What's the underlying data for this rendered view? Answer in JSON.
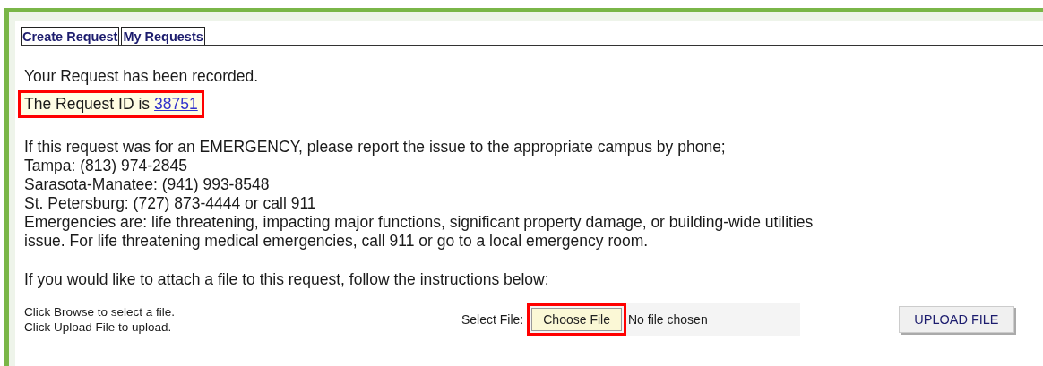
{
  "tabs": [
    {
      "label": "Create Request"
    },
    {
      "label": "My Requests"
    }
  ],
  "confirmation": {
    "message": "Your Request has been recorded.",
    "id_label": "The Request ID is",
    "request_id": "38751",
    "highlighted": true
  },
  "emergency": {
    "intro": "If this request was for an EMERGENCY, please report the issue to the appropriate campus by phone;",
    "contacts": [
      "Tampa: (813) 974-2845",
      "Sarasota-Manatee: (941) 993-8548",
      "St. Petersburg: (727) 873-4444 or call 911"
    ],
    "note": "Emergencies are: life threatening, impacting major functions, significant property damage, or building-wide utilities issue. For life threatening medical emergencies, call 911 or go to a local emergency room."
  },
  "attachment": {
    "intro": "If you would like to attach a file to this request, follow the instructions below:",
    "instructions": [
      "Click Browse to select a file.",
      "Click Upload File to upload."
    ],
    "select_label": "Select File:",
    "choose_button": {
      "label": "Choose File",
      "highlighted": true
    },
    "file_status": "No file chosen",
    "upload_button": "UPLOAD FILE"
  }
}
